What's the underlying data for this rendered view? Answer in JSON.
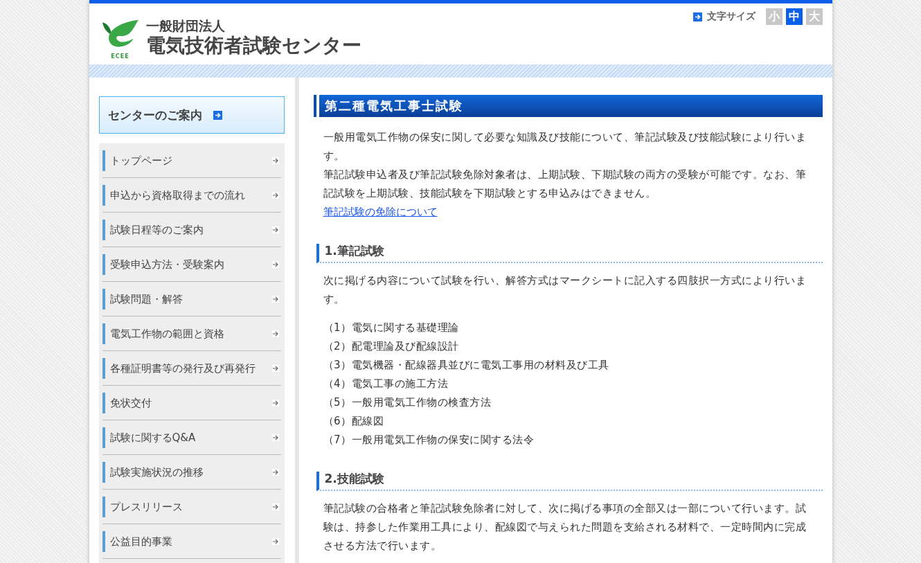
{
  "header": {
    "org_type": "一般財団法人",
    "org_name": "電気技術者試験センター",
    "logo_text": "ECEE",
    "font_size_label": "文字サイズ",
    "font_sizes": [
      {
        "label": "小",
        "selected": false
      },
      {
        "label": "中",
        "selected": true
      },
      {
        "label": "大",
        "selected": false
      }
    ]
  },
  "sidebar": {
    "guide_button": "センターのご案内",
    "items": [
      "トップページ",
      "申込から資格取得までの流れ",
      "試験日程等のご案内",
      "受験申込方法・受験案内",
      "試験問題・解答",
      "電気工作物の範囲と資格",
      "各種証明書等の発行及び再発行",
      "免状交付",
      "試験に関するQ&A",
      "試験実施状況の推移",
      "プレスリリース",
      "公益目的事業"
    ]
  },
  "main": {
    "title": "第二種電気工事士試験",
    "intro": [
      "一般用電気工作物の保安に関して必要な知識及び技能について、筆記試験及び技能試験により行います。",
      "筆記試験申込者及び筆記試験免除対象者は、上期試験、下期試験の両方の受験が可能です。なお、筆記試験を上期試験、技能試験を下期試験とする申込みはできません。"
    ],
    "link": "筆記試験の免除について",
    "sections": [
      {
        "heading": "1.筆記試験",
        "text": "次に掲げる内容について試験を行い、解答方式はマークシートに記入する四肢択一方式により行います。",
        "list": [
          {
            "num": "（1）",
            "text": "電気に関する基礎理論"
          },
          {
            "num": "（2）",
            "text": "配電理論及び配線設計"
          },
          {
            "num": "（3）",
            "text": "電気機器・配線器具並びに電気工事用の材料及び工具"
          },
          {
            "num": "（4）",
            "text": "電気工事の施工方法"
          },
          {
            "num": "（5）",
            "text": "一般用電気工作物の検査方法"
          },
          {
            "num": "（6）",
            "text": "配線図"
          },
          {
            "num": "（7）",
            "text": "一般用電気工作物の保安に関する法令"
          }
        ]
      },
      {
        "heading": "2.技能試験",
        "text": "筆記試験の合格者と筆記試験免除者に対して、次に掲げる事項の全部又は一部について行います。試験は、持参した作業用工具により、配線図で与えられた問題を支給される材料で、一定時間内に完成させる方法で行います。"
      }
    ]
  }
}
